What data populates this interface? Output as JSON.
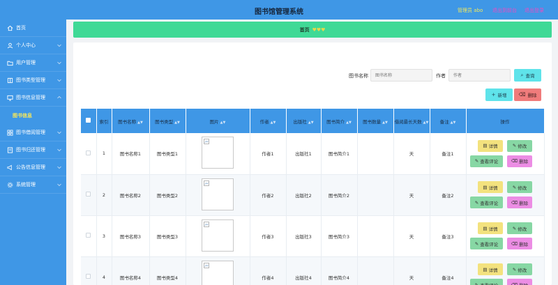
{
  "header": {
    "title": "图书馆管理系统",
    "user_label": "管理员 abo",
    "back_label": "退出到前台",
    "logout_label": "退出登录"
  },
  "sidebar": {
    "items": [
      {
        "label": "首页",
        "icon": "home-icon"
      },
      {
        "label": "个人中心",
        "icon": "user-icon"
      },
      {
        "label": "用户管理",
        "icon": "folder-icon"
      },
      {
        "label": "图书类型管理",
        "icon": "book-icon"
      },
      {
        "label": "图书信息管理",
        "icon": "monitor-icon"
      },
      {
        "label": "图书信息",
        "icon": "",
        "sub": true
      },
      {
        "label": "图书借阅管理",
        "icon": "grid-icon"
      },
      {
        "label": "图书归还管理",
        "icon": "return-icon"
      },
      {
        "label": "公告信息管理",
        "icon": "notice-icon"
      },
      {
        "label": "系统管理",
        "icon": "gear-icon"
      }
    ]
  },
  "breadcrumb": {
    "home": "首页",
    "hearts": "♥♥♥"
  },
  "search": {
    "name_label": "图书名称",
    "name_placeholder": "图书名称",
    "author_label": "作者",
    "author_placeholder": "作者",
    "query_label": "查询",
    "add_label": "新增",
    "delete_label": "删除"
  },
  "table": {
    "columns": [
      "索引",
      "图书名称",
      "图书类型",
      "图片",
      "作者",
      "出版社",
      "图书简介",
      "图书数量",
      "借阅最长天数",
      "备注",
      "操作"
    ],
    "rows": [
      {
        "index": "1",
        "name": "图书名称1",
        "type": "图书类型1",
        "author": "作者1",
        "publisher": "出版社1",
        "intro": "图书简介1",
        "qty": "",
        "days": "天",
        "note": "备注1"
      },
      {
        "index": "2",
        "name": "图书名称2",
        "type": "图书类型2",
        "author": "作者2",
        "publisher": "出版社2",
        "intro": "图书简介2",
        "qty": "",
        "days": "天",
        "note": "备注2"
      },
      {
        "index": "3",
        "name": "图书名称3",
        "type": "图书类型3",
        "author": "作者3",
        "publisher": "出版社3",
        "intro": "图书简介3",
        "qty": "",
        "days": "天",
        "note": "备注3"
      },
      {
        "index": "4",
        "name": "图书名称4",
        "type": "图书类型4",
        "author": "作者4",
        "publisher": "出版社4",
        "intro": "图书简介4",
        "qty": "",
        "days": "天",
        "note": "备注4"
      }
    ],
    "actions": {
      "detail": "详情",
      "edit": "修改",
      "comment": "查看评论",
      "delete": "删除"
    }
  },
  "colors": {
    "primary": "#3f97e6",
    "breadcrumb_bg": "#3fd996",
    "query_btn": "#5fe3ea",
    "add_btn": "#5fe3ea",
    "delete_btn": "#f07b7b",
    "detail_btn": "#f3e27e",
    "edit_btn": "#87d7a4",
    "remove_btn": "#ec8de4"
  }
}
